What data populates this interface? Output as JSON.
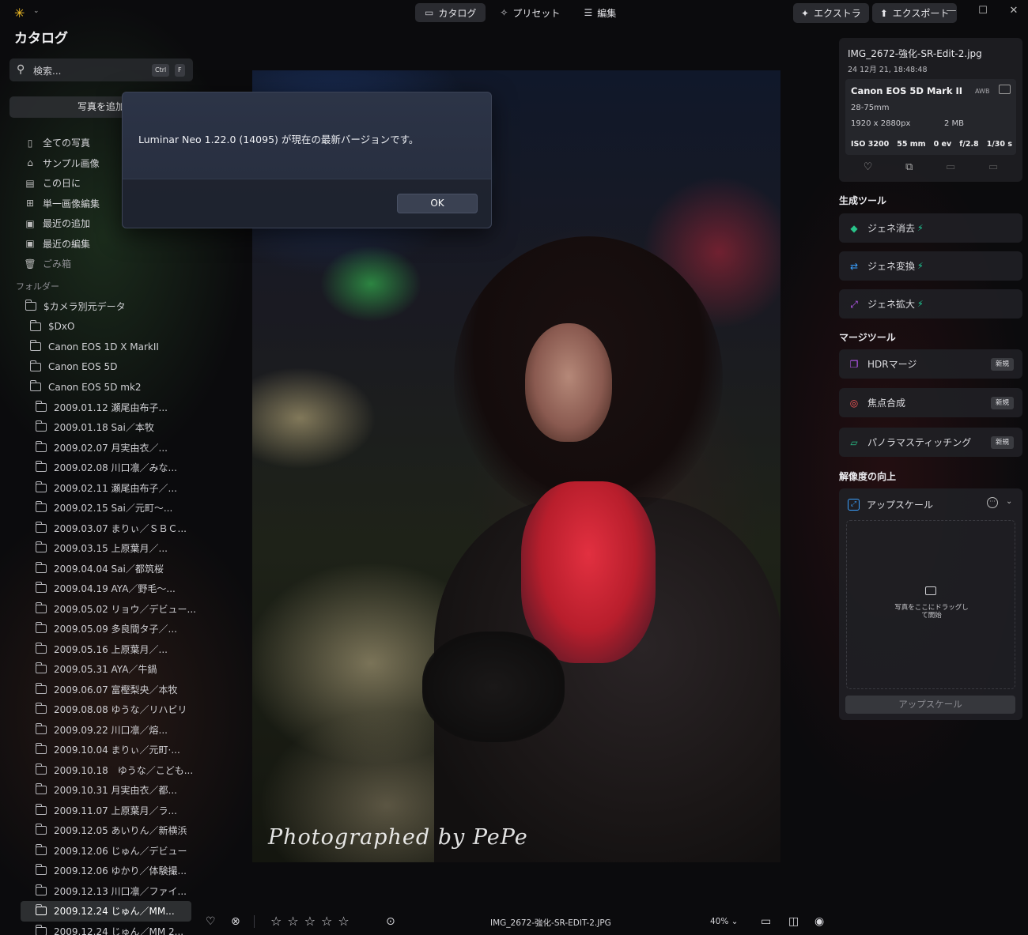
{
  "topbar": {
    "app_caret": "⌄",
    "modes": [
      {
        "label": "カタログ",
        "icon": "folder-icon",
        "active": true
      },
      {
        "label": "プリセット",
        "icon": "sparkle-icon",
        "active": false
      },
      {
        "label": "編集",
        "icon": "sliders-icon",
        "active": false
      }
    ],
    "extra_label": "エクストラ",
    "export_label": "エクスポート"
  },
  "sidebar": {
    "title": "カタログ",
    "search": {
      "placeholder": "検索...",
      "kbd1": "Ctrl",
      "kbd2": "F"
    },
    "add_photo": "写真を追加",
    "nav": [
      {
        "label": "全ての写真",
        "icon": "photos-icon"
      },
      {
        "label": "サンプル画像",
        "icon": "graduation-cap-icon"
      },
      {
        "label": "この日に",
        "icon": "calendar-icon"
      },
      {
        "label": "単一画像編集",
        "icon": "grid-icon"
      },
      {
        "label": "最近の追加",
        "icon": "recent-add-icon"
      },
      {
        "label": "最近の編集",
        "icon": "recent-edit-icon"
      },
      {
        "label": "ごみ箱",
        "icon": "trash-icon"
      }
    ],
    "folders_header": "フォルダー",
    "folders": [
      {
        "label": "$カメラ別元データ",
        "level": 0
      },
      {
        "label": "$DxO",
        "level": 1
      },
      {
        "label": "Canon EOS 1D X MarkII",
        "level": 1
      },
      {
        "label": "Canon EOS 5D",
        "level": 1
      },
      {
        "label": "Canon EOS 5D mk2",
        "level": 1
      },
      {
        "label": "2009.01.12 瀬尾由布子...",
        "level": 2
      },
      {
        "label": "2009.01.18 Sai／本牧",
        "level": 2
      },
      {
        "label": "2009.02.07 月実由衣／...",
        "level": 2
      },
      {
        "label": "2009.02.08 川口凛／みな...",
        "level": 2
      },
      {
        "label": "2009.02.11 瀬尾由布子／...",
        "level": 2
      },
      {
        "label": "2009.02.15 Sai／元町〜...",
        "level": 2
      },
      {
        "label": "2009.03.07 まりぃ／ＳＢＣ...",
        "level": 2
      },
      {
        "label": "2009.03.15 上原葉月／...",
        "level": 2
      },
      {
        "label": "2009.04.04 Sai／都筑桜",
        "level": 2
      },
      {
        "label": "2009.04.19 AYA／野毛〜...",
        "level": 2
      },
      {
        "label": "2009.05.02 リョウ／デビュー...",
        "level": 2
      },
      {
        "label": "2009.05.09 多良間タ子／...",
        "level": 2
      },
      {
        "label": "2009.05.16 上原葉月／...",
        "level": 2
      },
      {
        "label": "2009.05.31 AYA／牛鍋",
        "level": 2
      },
      {
        "label": "2009.06.07 富樫梨央／本牧",
        "level": 2
      },
      {
        "label": "2009.08.08 ゆうな／リハビリ",
        "level": 2
      },
      {
        "label": "2009.09.22 川口凛／熔...",
        "level": 2
      },
      {
        "label": "2009.10.04 まりぃ／元町·...",
        "level": 2
      },
      {
        "label": "2009.10.18　ゆうな／こども...",
        "level": 2
      },
      {
        "label": "2009.10.31 月実由衣／都...",
        "level": 2
      },
      {
        "label": "2009.11.07 上原葉月／ラ...",
        "level": 2
      },
      {
        "label": "2009.12.05 あいりん／新横浜",
        "level": 2
      },
      {
        "label": "2009.12.06 じゅん／デビュー",
        "level": 2
      },
      {
        "label": "2009.12.06 ゆかり／体験撮...",
        "level": 2
      },
      {
        "label": "2009.12.13 川口凛／ファイ...",
        "level": 2
      },
      {
        "label": "2009.12.24 じゅん／MM...",
        "level": 2,
        "selected": true
      },
      {
        "label": "2009.12.24 じゅん／MM 2...",
        "level": 2
      }
    ]
  },
  "dialog": {
    "message": "Luminar Neo 1.22.0 (14095) が現在の最新バージョンです。",
    "ok_label": "OK"
  },
  "photo": {
    "watermark": "Photographed by PePe"
  },
  "info": {
    "filename": "IMG_2672-強化-SR-Edit-2.jpg",
    "date": "24 12月 21, 18:48:48",
    "camera": "Canon EOS 5D Mark II",
    "awb": "AWB",
    "lens": "28-75mm",
    "dimensions": "1920 x 2880px",
    "filesize": "2 MB",
    "iso": "ISO 3200",
    "focal": "55 mm",
    "ev": "0 ev",
    "aperture": "f/2.8",
    "shutter": "1/30 s"
  },
  "gen_tools": {
    "header": "生成ツール",
    "items": [
      {
        "label": "ジェネ消去",
        "icon": "eraser-icon",
        "color": "#29c48a"
      },
      {
        "label": "ジェネ変換",
        "icon": "swap-icon",
        "color": "#3aa0ff"
      },
      {
        "label": "ジェネ拡大",
        "icon": "expand-icon",
        "color": "#c25cff"
      }
    ],
    "bolt": "⚡"
  },
  "merge_tools": {
    "header": "マージツール",
    "badge": "新規",
    "items": [
      {
        "label": "HDRマージ",
        "icon": "hdr-icon",
        "color": "#c25cff"
      },
      {
        "label": "焦点合成",
        "icon": "focus-icon",
        "color": "#ff5a5a"
      },
      {
        "label": "パノラマスティッチング",
        "icon": "panorama-icon",
        "color": "#29c48a"
      }
    ]
  },
  "resolution": {
    "header": "解像度の向上",
    "tool_label": "アップスケール",
    "drop_text": "写真をここにドラッグして開始",
    "button_label": "アップスケール"
  },
  "bottombar": {
    "filename": "IMG_2672-強化-SR-EDIT-2.JPG",
    "zoom": "40% ⌄",
    "stars": [
      "☆",
      "☆",
      "☆",
      "☆",
      "☆"
    ]
  }
}
